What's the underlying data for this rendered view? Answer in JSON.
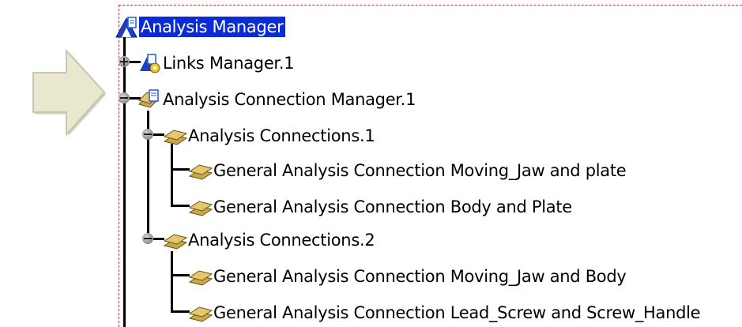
{
  "tree": {
    "root": {
      "label": "Analysis Manager",
      "icon": "analysis-manager-icon",
      "selected": true
    },
    "links_manager": {
      "label": "Links Manager.1",
      "icon": "links-manager-icon",
      "expander": "plus"
    },
    "connection_manager": {
      "label": "Analysis Connection Manager.1",
      "icon": "connection-manager-icon",
      "expander": "minus"
    },
    "connections_1": {
      "label": "Analysis Connections.1",
      "icon": "connection-set-icon",
      "expander": "minus",
      "children": [
        {
          "label": "General Analysis Connection Moving_Jaw and plate",
          "icon": "connection-icon"
        },
        {
          "label": "General Analysis Connection Body and Plate",
          "icon": "connection-icon"
        }
      ]
    },
    "connections_2": {
      "label": "Analysis Connections.2",
      "icon": "connection-set-icon",
      "expander": "minus",
      "children": [
        {
          "label": "General Analysis Connection Moving_Jaw and Body",
          "icon": "connection-icon"
        },
        {
          "label": "General Analysis Connection Lead_Screw and Screw_Handle",
          "icon": "connection-icon"
        }
      ]
    }
  },
  "pointer": {
    "icon": "right-arrow-icon"
  },
  "colors": {
    "selection": "#0a2bd6",
    "frame": "#b04040",
    "connection_icon": "#c9a84a",
    "arrow_fill": "#e9e8cf"
  }
}
